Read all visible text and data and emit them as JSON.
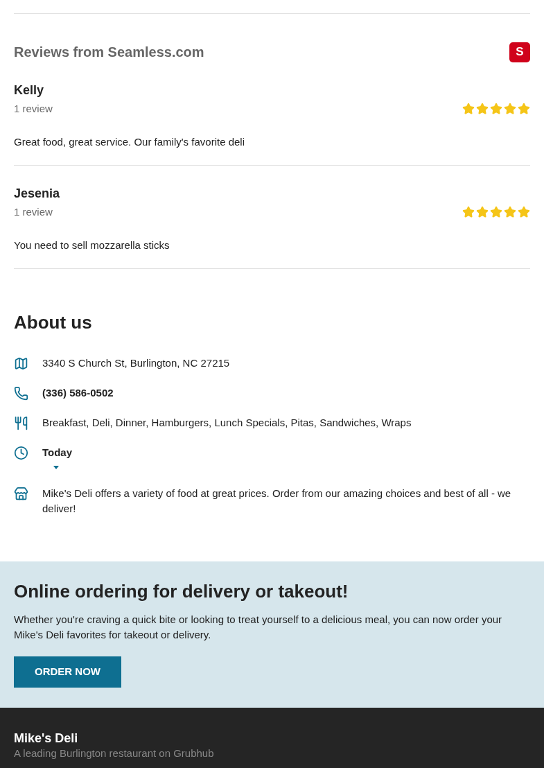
{
  "reviews": {
    "title": "Reviews from Seamless.com",
    "logo_letter": "S",
    "items": [
      {
        "name": "Kelly",
        "count": "1 review",
        "stars": 5,
        "text": "Great food, great service. Our family's favorite deli"
      },
      {
        "name": "Jesenia",
        "count": "1 review",
        "stars": 5,
        "text": "You need to sell mozzarella sticks"
      }
    ]
  },
  "about": {
    "title": "About us",
    "rows": [
      {
        "kind": "address",
        "text": "3340 S Church St, Burlington, NC 27215"
      },
      {
        "kind": "phone",
        "text": "(336) 586-0502"
      },
      {
        "kind": "cuisines",
        "text": "Breakfast, Deli, Dinner, Hamburgers, Lunch Specials, Pitas, Sandwiches, Wraps"
      },
      {
        "kind": "hours",
        "text": "Today",
        "expanded": false
      },
      {
        "kind": "description",
        "text": "Mike's Deli offers a variety of food at great prices. Order from our amazing choices and best of all - we deliver!"
      }
    ]
  },
  "promo": {
    "title": "Online ordering for delivery or takeout!",
    "text": "Whether you're craving a quick bite or looking to treat yourself to a delicious meal, you can now order your Mike's Deli favorites for takeout or delivery.",
    "button": "ORDER NOW"
  },
  "footer": {
    "name": "Mike's Deli",
    "tagline": "A leading Burlington restaurant on Grubhub"
  }
}
